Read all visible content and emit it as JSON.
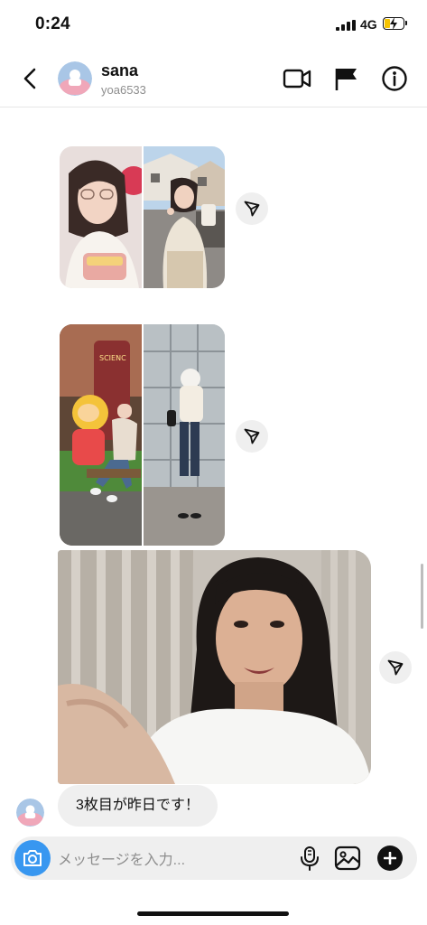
{
  "status_bar": {
    "time": "0:24",
    "network": "4G",
    "battery_level": 0.3
  },
  "header": {
    "title": "sana",
    "subtitle": "yoa6533"
  },
  "messages": [
    {
      "type": "image-pair",
      "sender": "contact"
    },
    {
      "type": "image-pair",
      "sender": "contact"
    },
    {
      "type": "image",
      "sender": "contact"
    },
    {
      "type": "text",
      "sender": "contact",
      "text": "3枚目が昨日です！"
    }
  ],
  "composer": {
    "placeholder": "メッセージを入力..."
  },
  "colors": {
    "accent": "#3897f0",
    "bubble": "#efefef",
    "battery": "#f6c300"
  },
  "icons": [
    "back-chevron-icon",
    "video-call-icon",
    "flag-icon",
    "info-icon",
    "share-icon",
    "camera-icon",
    "microphone-icon",
    "gallery-icon",
    "plus-icon"
  ]
}
